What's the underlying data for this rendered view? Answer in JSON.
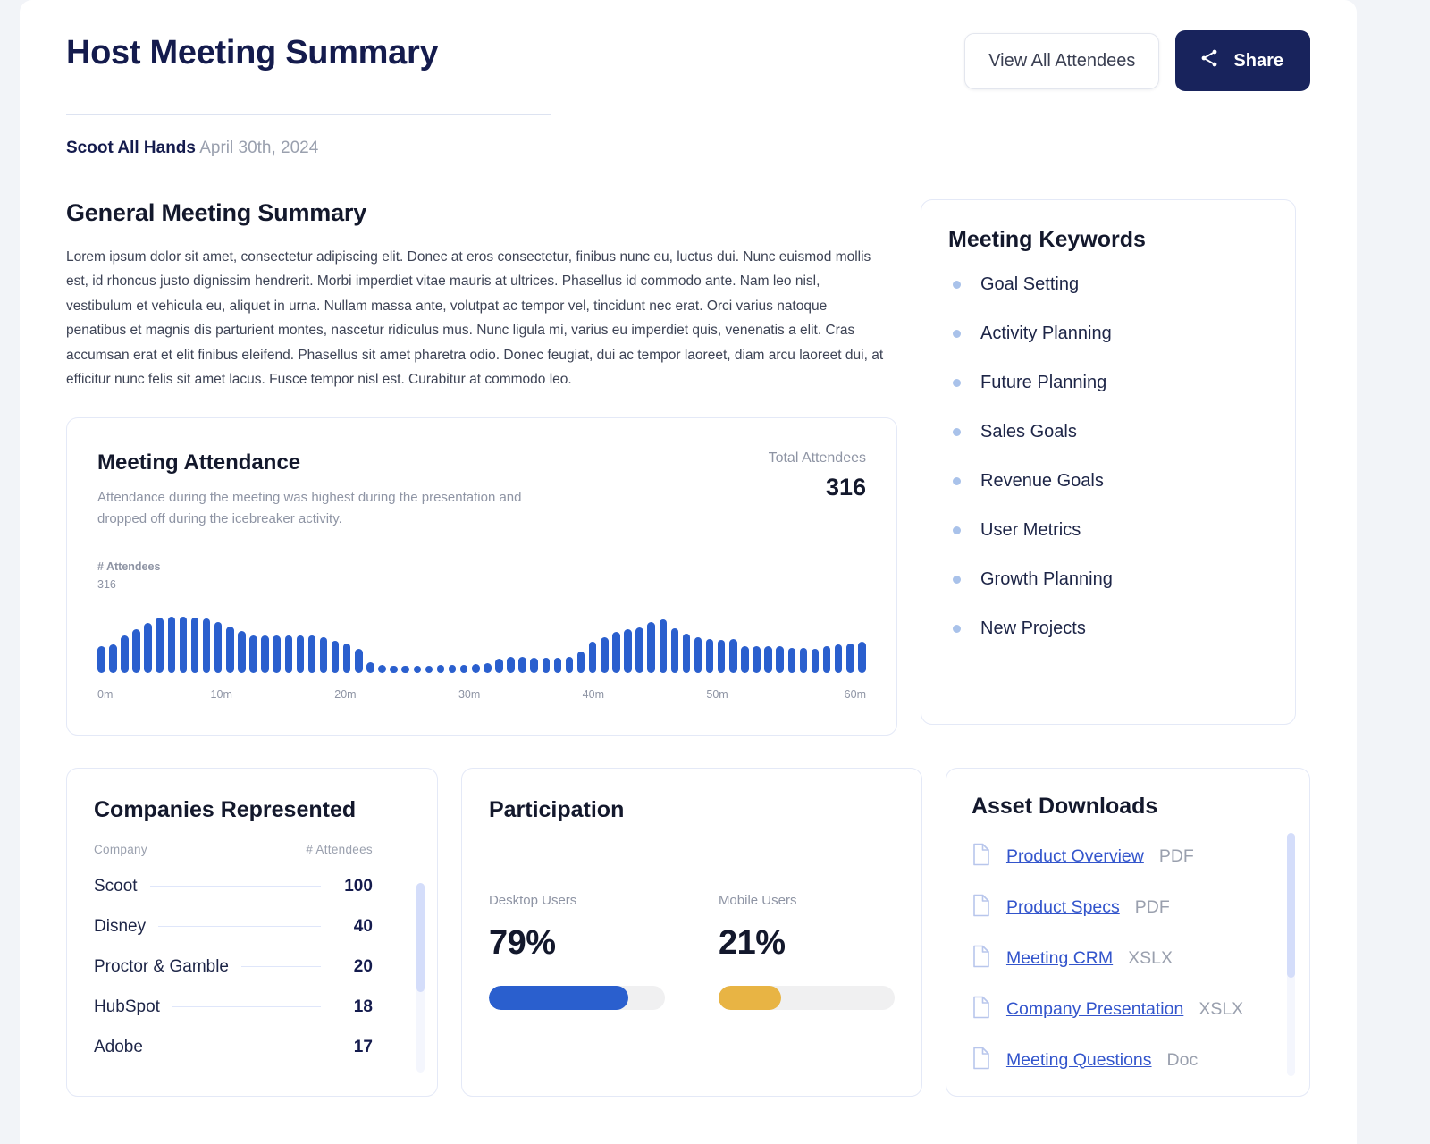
{
  "header": {
    "title": "Host Meeting Summary",
    "view_all_label": "View All Attendees",
    "share_label": "Share",
    "meeting_name": "Scoot All Hands",
    "meeting_date": "April 30th, 2024"
  },
  "summary": {
    "heading": "General Meeting Summary",
    "body": "Lorem ipsum dolor sit amet, consectetur adipiscing elit. Donec at eros consectetur, finibus nunc eu, luctus dui. Nunc euismod mollis est, id rhoncus justo dignissim hendrerit. Morbi imperdiet vitae mauris at ultrices. Phasellus id commodo ante. Nam leo nisl, vestibulum et vehicula eu, aliquet in urna. Nullam massa ante, volutpat ac tempor vel, tincidunt nec erat. Orci varius natoque penatibus et magnis dis parturient montes, nascetur ridiculus mus. Nunc ligula mi, varius eu imperdiet quis, venenatis a elit. Cras accumsan erat et elit finibus eleifend. Phasellus sit amet pharetra odio. Donec feugiat, dui ac tempor laoreet, diam arcu laoreet dui, at efficitur nunc felis sit amet lacus. Fusce tempor nisl est. Curabitur at commodo leo."
  },
  "attendance": {
    "title": "Meeting Attendance",
    "subtitle": "Attendance during the meeting was highest during the presentation and dropped off during the icebreaker activity.",
    "total_label": "Total Attendees",
    "total_value": "316"
  },
  "chart_data": {
    "type": "bar",
    "title": "Meeting Attendance",
    "xlabel": "",
    "ylabel": "# Attendees",
    "y_axis_label": "# Attendees",
    "y_max_label": "316",
    "ylim": [
      0,
      316
    ],
    "xlim": [
      0,
      62
    ],
    "grid": false,
    "legend": null,
    "bar_color": "#2a5fce",
    "x_tick_labels": [
      "0m",
      "10m",
      "20m",
      "30m",
      "40m",
      "50m",
      "60m"
    ],
    "x_tick_positions": [
      0,
      10,
      20,
      30,
      40,
      50,
      60
    ],
    "x_unit": "minutes",
    "values": [
      118,
      128,
      168,
      195,
      225,
      250,
      252,
      252,
      250,
      245,
      228,
      210,
      188,
      168,
      168,
      168,
      168,
      170,
      168,
      162,
      142,
      130,
      108,
      48,
      34,
      30,
      30,
      32,
      32,
      34,
      34,
      36,
      40,
      44,
      62,
      70,
      70,
      68,
      66,
      66,
      72,
      96,
      140,
      160,
      185,
      198,
      205,
      228,
      240,
      200,
      178,
      160,
      152,
      150,
      152,
      120,
      118,
      118,
      118,
      112,
      112,
      108,
      118,
      128,
      130,
      138
    ]
  },
  "keywords": {
    "title": "Meeting Keywords",
    "items": [
      "Goal Setting",
      "Activity Planning",
      "Future Planning",
      "Sales Goals",
      "Revenue Goals",
      "User Metrics",
      "Growth Planning",
      "New Projects"
    ]
  },
  "companies": {
    "title": "Companies Represented",
    "col_company": "Company",
    "col_attendees": "# Attendees",
    "rows": [
      {
        "name": "Scoot",
        "count": "100"
      },
      {
        "name": "Disney",
        "count": "40"
      },
      {
        "name": "Proctor & Gamble",
        "count": "20"
      },
      {
        "name": "HubSpot",
        "count": "18"
      },
      {
        "name": "Adobe",
        "count": "17"
      }
    ]
  },
  "participation": {
    "title": "Participation",
    "desktop_label": "Desktop Users",
    "desktop_value": "79%",
    "desktop_pct": 79,
    "desktop_color": "#2a5fce",
    "mobile_label": "Mobile Users",
    "mobile_value": "21%",
    "mobile_pct": 21,
    "mobile_color": "#e8b444"
  },
  "assets": {
    "title": "Asset Downloads",
    "items": [
      {
        "name": "Product Overview",
        "type": "PDF"
      },
      {
        "name": "Product Specs",
        "type": "PDF"
      },
      {
        "name": "Meeting CRM",
        "type": "XSLX"
      },
      {
        "name": "Company Presentation",
        "type": "XSLX"
      },
      {
        "name": "Meeting Questions",
        "type": "Doc"
      }
    ]
  },
  "colors": {
    "brand_navy": "#18235c",
    "accent_blue": "#2a5fce",
    "accent_gold": "#e8b444",
    "link": "#3355cc",
    "page_bg": "#f2f4f8"
  }
}
